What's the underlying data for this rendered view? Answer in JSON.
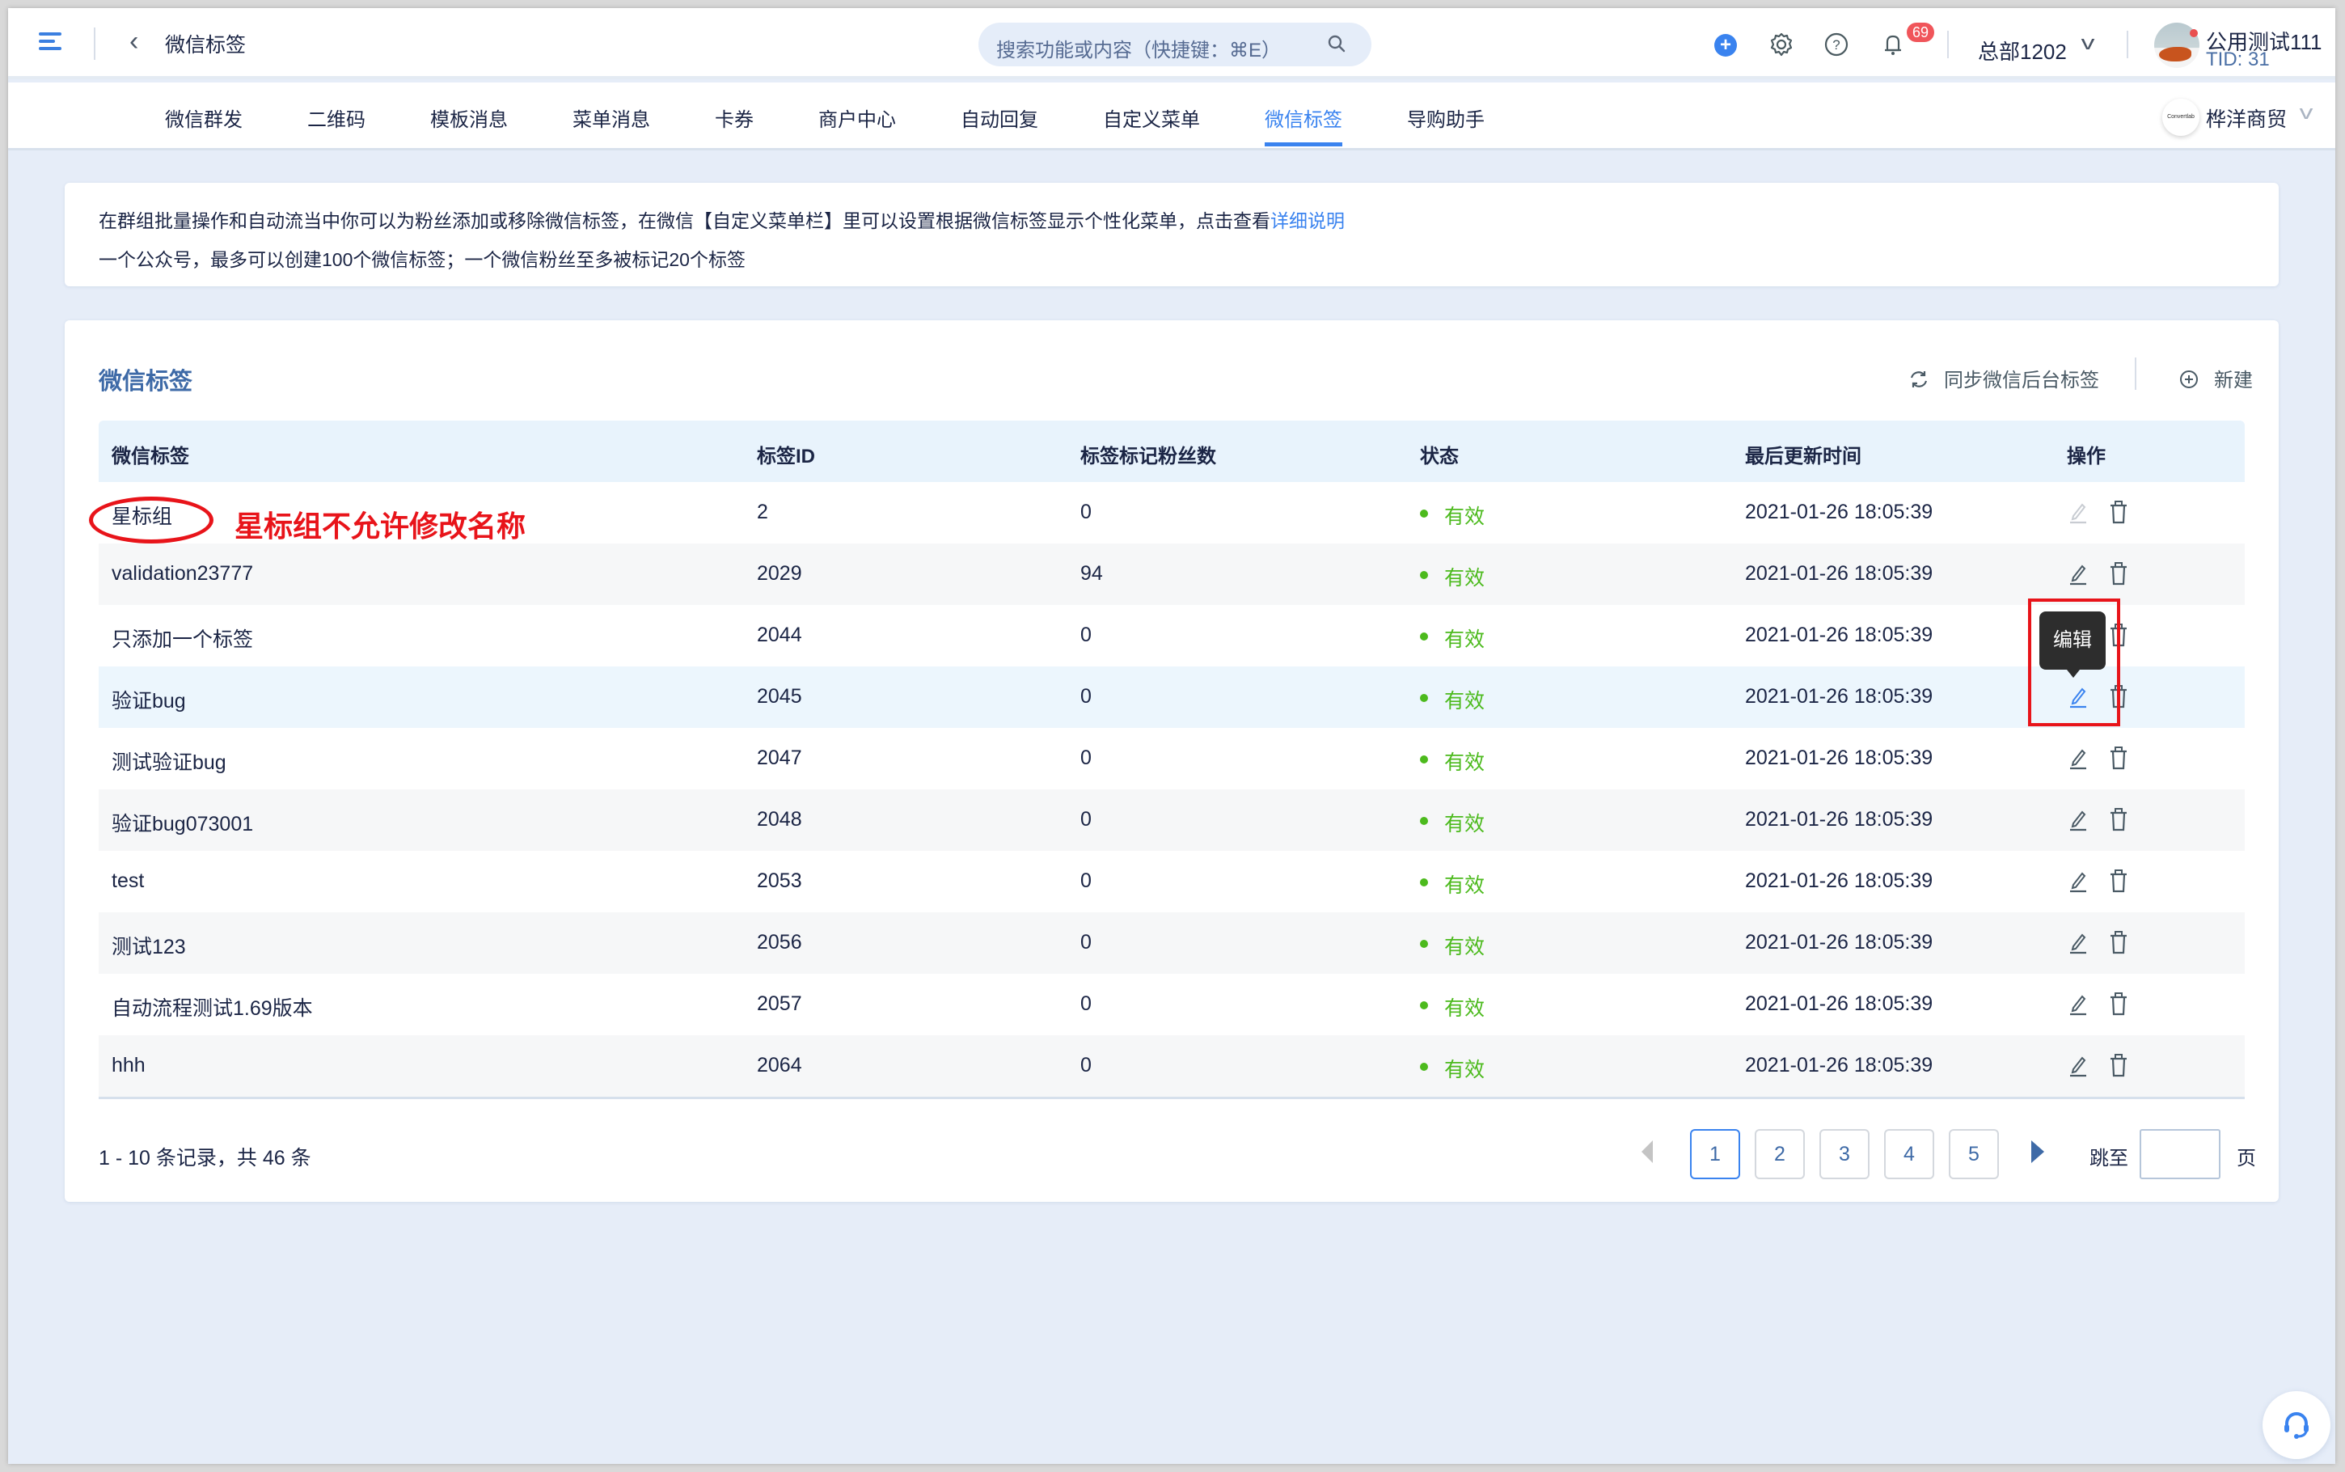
{
  "header": {
    "page_title": "微信标签",
    "search_placeholder": "搜索功能或内容（快捷键：⌘E）",
    "notification_count": "69",
    "org_name": "总部1202",
    "user_name": "公用测试111",
    "user_tid": "TID: 31",
    "icons": [
      "menu-icon",
      "back-icon",
      "search-icon",
      "plus-icon",
      "gear-icon",
      "help-icon",
      "bell-icon",
      "chevron-down-icon"
    ]
  },
  "tabs": [
    {
      "label": "微信群发",
      "active": false
    },
    {
      "label": "二维码",
      "active": false
    },
    {
      "label": "模板消息",
      "active": false
    },
    {
      "label": "菜单消息",
      "active": false
    },
    {
      "label": "卡券",
      "active": false
    },
    {
      "label": "商户中心",
      "active": false
    },
    {
      "label": "自动回复",
      "active": false
    },
    {
      "label": "自定义菜单",
      "active": false
    },
    {
      "label": "微信标签",
      "active": true
    },
    {
      "label": "导购助手",
      "active": false
    }
  ],
  "shop": {
    "logo_text": "Convertlab",
    "name": "桦洋商贸"
  },
  "info": {
    "line1": "在群组批量操作和自动流当中你可以为粉丝添加或移除微信标签，在微信【自定义菜单栏】里可以设置根据微信标签显示个性化菜单，点击查看",
    "link": "详细说明",
    "line2": "一个公众号，最多可以创建100个微信标签；一个微信粉丝至多被标记20个标签"
  },
  "section": {
    "title": "微信标签",
    "sync_label": "同步微信后台标签",
    "new_label": "新建"
  },
  "table": {
    "columns": [
      "微信标签",
      "标签ID",
      "标签标记粉丝数",
      "状态",
      "最后更新时间",
      "操作"
    ],
    "rows": [
      {
        "name": "星标组",
        "id": "2",
        "fans": "0",
        "status": "有效",
        "updated": "2021-01-26 18:05:39",
        "edit_disabled": true
      },
      {
        "name": "validation23777",
        "id": "2029",
        "fans": "94",
        "status": "有效",
        "updated": "2021-01-26 18:05:39",
        "edit_disabled": false
      },
      {
        "name": "只添加一个标签",
        "id": "2044",
        "fans": "0",
        "status": "有效",
        "updated": "2021-01-26 18:05:39",
        "edit_disabled": false
      },
      {
        "name": "验证bug",
        "id": "2045",
        "fans": "0",
        "status": "有效",
        "updated": "2021-01-26 18:05:39",
        "edit_disabled": false
      },
      {
        "name": "测试验证bug",
        "id": "2047",
        "fans": "0",
        "status": "有效",
        "updated": "2021-01-26 18:05:39",
        "edit_disabled": false
      },
      {
        "name": "验证bug073001",
        "id": "2048",
        "fans": "0",
        "status": "有效",
        "updated": "2021-01-26 18:05:39",
        "edit_disabled": false
      },
      {
        "name": "test",
        "id": "2053",
        "fans": "0",
        "status": "有效",
        "updated": "2021-01-26 18:05:39",
        "edit_disabled": false
      },
      {
        "name": "测试123",
        "id": "2056",
        "fans": "0",
        "status": "有效",
        "updated": "2021-01-26 18:05:39",
        "edit_disabled": false
      },
      {
        "name": "自动流程测试1.69版本",
        "id": "2057",
        "fans": "0",
        "status": "有效",
        "updated": "2021-01-26 18:05:39",
        "edit_disabled": false
      },
      {
        "name": "hhh",
        "id": "2064",
        "fans": "0",
        "status": "有效",
        "updated": "2021-01-26 18:05:39",
        "edit_disabled": false
      }
    ],
    "hovered_row": 3
  },
  "tooltip": "编辑",
  "annotation": "星标组不允许修改名称",
  "pagination": {
    "record_summary": "1 - 10 条记录，共 46 条",
    "pages": [
      "1",
      "2",
      "3",
      "4",
      "5"
    ],
    "current_page": "1",
    "jump_label": "跳至",
    "jump_value": "",
    "page_suffix": "页"
  },
  "colors": {
    "accent": "#3a83ef",
    "status_valid": "#4cba1d",
    "annotation_red": "#e8141a",
    "section_title": "#3e6aa7"
  }
}
